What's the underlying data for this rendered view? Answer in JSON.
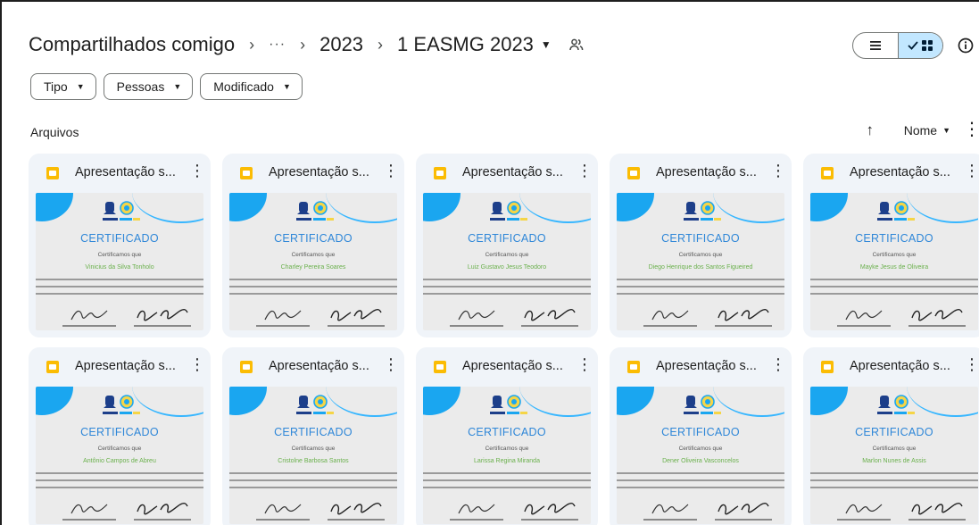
{
  "breadcrumb": {
    "root": "Compartilhados comigo",
    "overflow": "···",
    "separator": "›",
    "parent": "2023",
    "current": "1 EASMG 2023"
  },
  "filters": [
    {
      "label": "Tipo"
    },
    {
      "label": "Pessoas"
    },
    {
      "label": "Modificado"
    }
  ],
  "section": {
    "title": "Arquivos",
    "sort_label": "Nome"
  },
  "cert": {
    "title": "CERTIFICADO",
    "certify_text": "Certificamos que"
  },
  "files": [
    {
      "title": "Apresentação s...",
      "recipient": "Vinicius da Silva Tonholo"
    },
    {
      "title": "Apresentação s...",
      "recipient": "Charley Pereira Soares"
    },
    {
      "title": "Apresentação s...",
      "recipient": "Luiz Gustavo Jesus Teodoro"
    },
    {
      "title": "Apresentação s...",
      "recipient": "Diego Henrique dos Santos Figueired"
    },
    {
      "title": "Apresentação s...",
      "recipient": "Mayke Jesus de Oliveira"
    },
    {
      "title": "Apresentação s...",
      "recipient": "Antônio Campos de Abreu"
    },
    {
      "title": "Apresentação s...",
      "recipient": "Cristolne Barbosa Santos"
    },
    {
      "title": "Apresentação s...",
      "recipient": "Larissa Regina Miranda"
    },
    {
      "title": "Apresentação s...",
      "recipient": "Dener Oliveira Vasconcelos"
    },
    {
      "title": "Apresentação s...",
      "recipient": "Marlon Nunes de Assis"
    }
  ],
  "colors": {
    "accent": "#c2e7ff",
    "slides_icon": "#fbbc04",
    "card_bg": "#f0f4f9",
    "cert_blue": "#2f87d8",
    "cert_green": "#6ab04c"
  },
  "icons": {
    "shared": "people-icon",
    "list_view": "list-icon",
    "grid_view": "grid-icon",
    "info": "info-icon",
    "sort": "arrow-up-icon",
    "more": "more-vert-icon",
    "file_type": "slides-icon"
  }
}
